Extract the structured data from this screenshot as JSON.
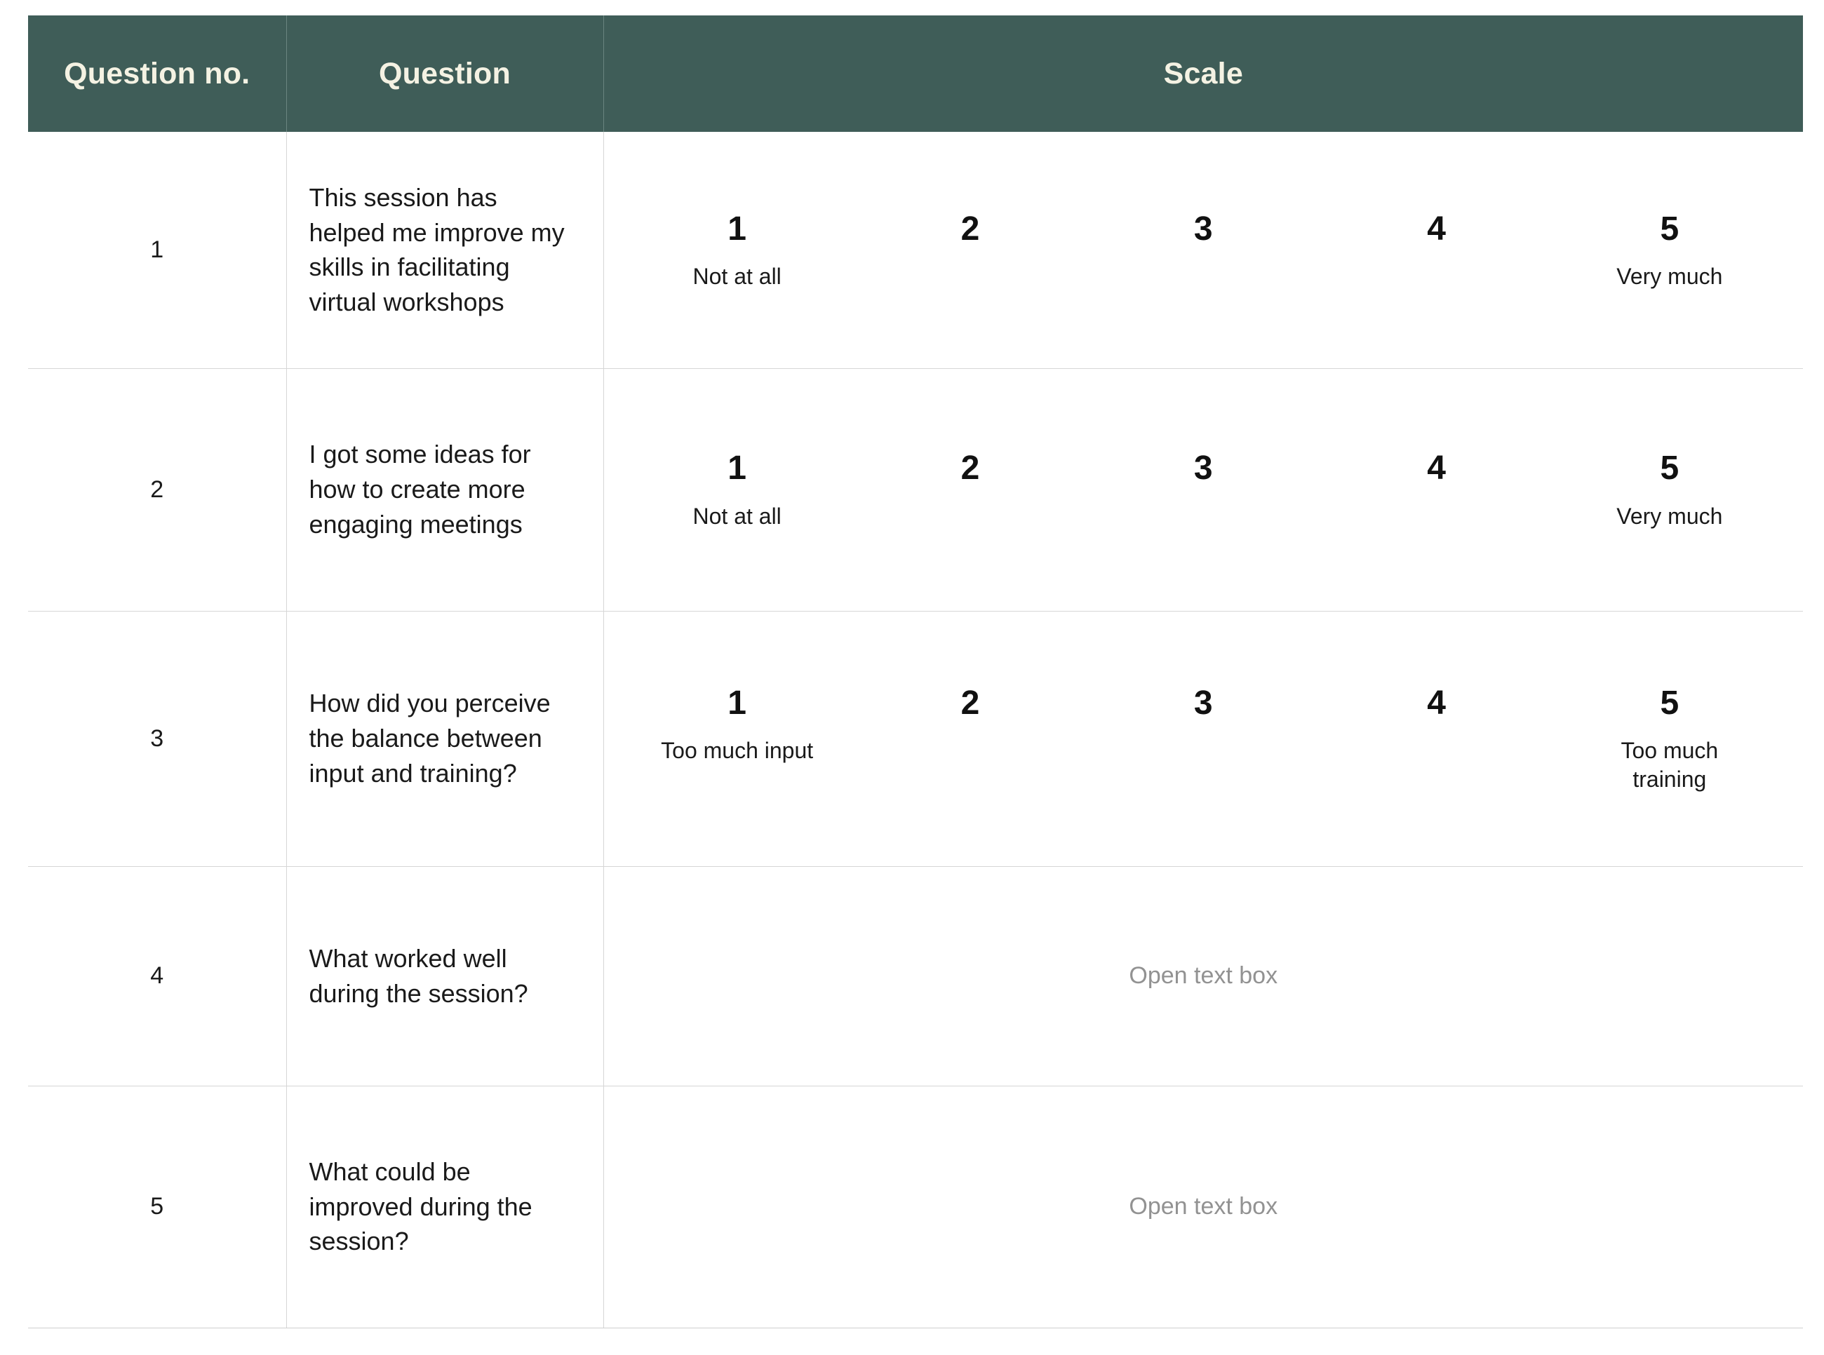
{
  "colors": {
    "header_bg": "#3F5D58",
    "header_text": "#F4F2E3",
    "body_text": "#1a1a1a",
    "placeholder_text": "#929292",
    "grid_line": "#d6d6d6"
  },
  "table": {
    "headers": {
      "question_no": "Question no.",
      "question": "Question",
      "scale": "Scale"
    },
    "rows": [
      {
        "no": "1",
        "question": "This session has helped me improve my skills in facilitating virtual workshops",
        "answer_type": "likert",
        "scale": {
          "points": [
            "1",
            "2",
            "3",
            "4",
            "5"
          ],
          "anchors": [
            "Not at all",
            "",
            "",
            "",
            "Very much"
          ]
        }
      },
      {
        "no": "2",
        "question": "I got some ideas for how to create more engaging meetings",
        "answer_type": "likert",
        "scale": {
          "points": [
            "1",
            "2",
            "3",
            "4",
            "5"
          ],
          "anchors": [
            "Not at all",
            "",
            "",
            "",
            "Very much"
          ]
        }
      },
      {
        "no": "3",
        "question": "How did you perceive the balance between input and training?",
        "answer_type": "likert",
        "scale": {
          "points": [
            "1",
            "2",
            "3",
            "4",
            "5"
          ],
          "anchors": [
            "Too much input",
            "",
            "",
            "",
            "Too much training"
          ]
        }
      },
      {
        "no": "4",
        "question": "What worked well during the session?",
        "answer_type": "open",
        "open_text_placeholder": "Open text box"
      },
      {
        "no": "5",
        "question": "What could be improved during the session?",
        "answer_type": "open",
        "open_text_placeholder": "Open text box"
      }
    ]
  }
}
